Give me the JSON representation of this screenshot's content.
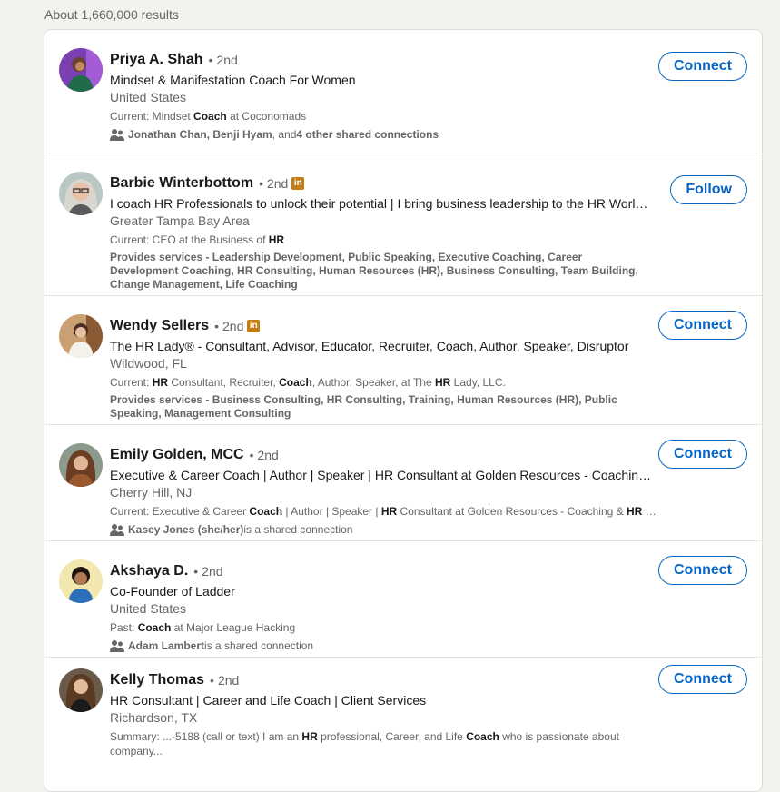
{
  "search": {
    "results_count": "About 1,660,000 results"
  },
  "colors": {
    "link_blue": "#0a66c2",
    "premium_gold": "#c37d16"
  },
  "results": [
    {
      "name": "Priya A. Shah",
      "degree": "2nd",
      "headline": "Mindset & Manifestation Coach For Women",
      "location": "United States",
      "summary_parts": [
        "Current: Mindset ",
        "Coach",
        " at Coconomads"
      ],
      "shared_parts": [
        "Jonathan Chan, Benji Hyam",
        ", and ",
        "4 other shared connections"
      ],
      "action": "Connect"
    },
    {
      "name": "Barbie Winterbottom",
      "degree": "2nd",
      "premium_icon": "linkedin-premium-icon",
      "headline": "I coach HR Professionals to unlock their potential | I bring business leadership to the HR World | AI…",
      "location": "Greater Tampa Bay Area",
      "summary_parts": [
        "Current: CEO at the Business of ",
        "HR"
      ],
      "services": "Provides services - Leadership Development, Public Speaking, Executive Coaching, Career Development Coaching, HR Consulting, Human Resources (HR), Business Consulting, Team Building, Change Management, Life Coaching",
      "action": "Follow"
    },
    {
      "name": "Wendy Sellers",
      "degree": "2nd",
      "premium_icon": "linkedin-premium-icon",
      "headline": "The HR Lady® - Consultant, Advisor, Educator, Recruiter, Coach, Author, Speaker, Disruptor",
      "location": "Wildwood, FL",
      "summary_parts": [
        "Current: ",
        "HR",
        " Consultant, Recruiter, ",
        "Coach",
        ", Author, Speaker, at The ",
        "HR",
        " Lady, LLC."
      ],
      "services": "Provides services - Business Consulting, HR Consulting, Training, Human Resources (HR), Public Speaking, Management Consulting",
      "action": "Connect"
    },
    {
      "name": "Emily Golden, MCC",
      "degree": "2nd",
      "headline": "Executive & Career Coach | Author | Speaker | HR Consultant at Golden Resources - Coaching & HR",
      "location": "Cherry Hill, NJ",
      "summary_parts": [
        "Current: Executive & Career ",
        "Coach",
        " | Author | Speaker | ",
        "HR",
        " Consultant at Golden Resources - Coaching & ",
        "HR",
        " Consulting"
      ],
      "shared_parts": [
        "Kasey Jones (she/her)",
        " is a shared connection"
      ],
      "action": "Connect"
    },
    {
      "name": "Akshaya D.",
      "degree": "2nd",
      "headline": "Co-Founder of Ladder",
      "location": "United States",
      "summary_parts": [
        "Past: ",
        "Coach",
        " at Major League Hacking"
      ],
      "shared_parts": [
        "Adam Lambert",
        " is a shared connection"
      ],
      "action": "Connect"
    },
    {
      "name": "Kelly Thomas",
      "degree": "2nd",
      "headline": "HR Consultant | Career and Life Coach | Client Services",
      "location": "Richardson, TX",
      "summary_parts": [
        "Summary: ...-5188 (call or text) I am an ",
        "HR",
        " professional, Career, and Life ",
        "Coach",
        " who is passionate about company..."
      ],
      "action": "Connect"
    }
  ]
}
